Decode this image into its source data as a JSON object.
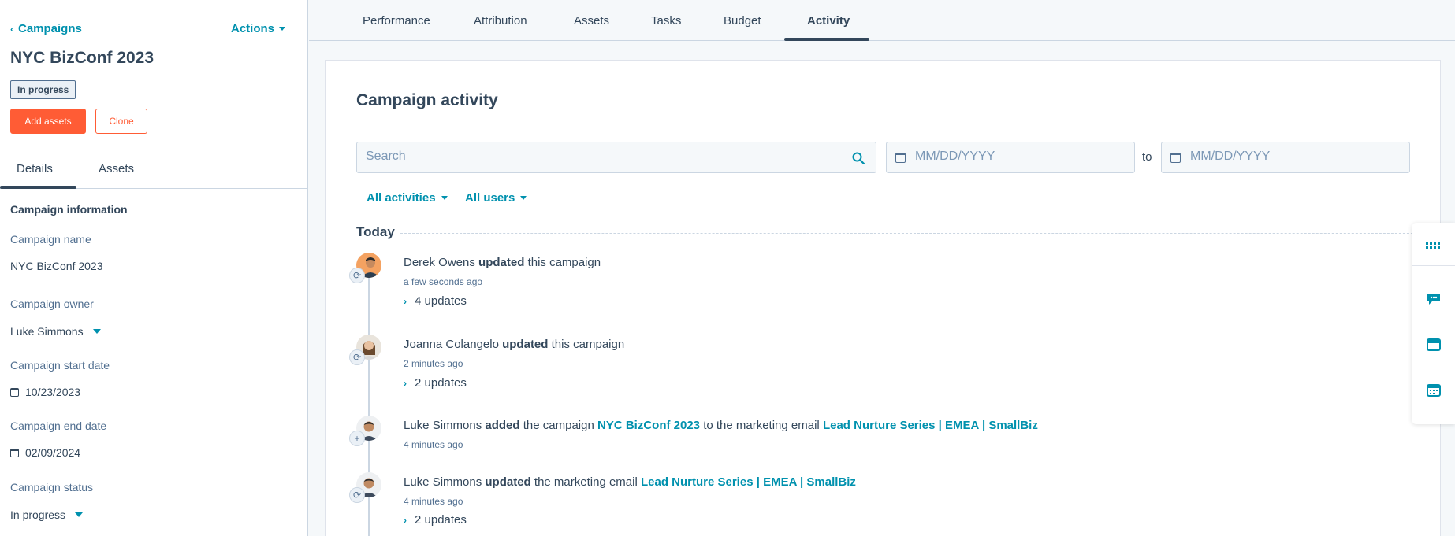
{
  "sidebar": {
    "back_label": "Campaigns",
    "actions_label": "Actions",
    "title": "NYC BizConf 2023",
    "status_badge": "In progress",
    "add_assets_label": "Add assets",
    "clone_label": "Clone",
    "tabs": [
      {
        "label": "Details"
      },
      {
        "label": "Assets"
      }
    ],
    "section_title": "Campaign information",
    "fields": {
      "name": {
        "label": "Campaign name",
        "value": "NYC BizConf 2023"
      },
      "owner": {
        "label": "Campaign owner",
        "value": "Luke Simmons"
      },
      "start": {
        "label": "Campaign start date",
        "value": "10/23/2023"
      },
      "end": {
        "label": "Campaign end date",
        "value": "02/09/2024"
      },
      "status": {
        "label": "Campaign status",
        "value": "In progress"
      }
    }
  },
  "topnav": {
    "tabs": [
      {
        "label": "Performance"
      },
      {
        "label": "Attribution"
      },
      {
        "label": "Assets"
      },
      {
        "label": "Tasks"
      },
      {
        "label": "Budget"
      },
      {
        "label": "Activity"
      }
    ],
    "active": "Activity"
  },
  "main": {
    "title": "Campaign activity",
    "search_placeholder": "Search",
    "date_from_placeholder": "MM/DD/YYYY",
    "to_label": "to",
    "date_to_placeholder": "MM/DD/YYYY",
    "filters": {
      "activities": "All activities",
      "users": "All users"
    },
    "today_label": "Today",
    "entries": [
      {
        "user": "Derek Owens",
        "action": "updated",
        "rest": "this campaign",
        "time": "a few seconds ago",
        "updates": "4 updates"
      },
      {
        "user": "Joanna Colangelo",
        "action": "updated",
        "rest": "this campaign",
        "time": "2 minutes ago",
        "updates": "2 updates"
      },
      {
        "user": "Luke Simmons",
        "action": "added",
        "pre": "the campaign",
        "link1": "NYC BizConf 2023",
        "mid": "to the marketing email",
        "link2": "Lead Nurture Series | EMEA | SmallBiz",
        "time": "4 minutes ago"
      },
      {
        "user": "Luke Simmons",
        "action": "updated",
        "pre": "the marketing email",
        "link1": "Lead Nurture Series | EMEA | SmallBiz",
        "time": "4 minutes ago",
        "updates": "2 updates"
      }
    ]
  },
  "colors": {
    "accent": "#0091ae",
    "primary_button": "#ff5c35",
    "text": "#33475b"
  },
  "icons": {
    "search": "search-icon",
    "calendar": "calendar-icon",
    "sync": "sync-icon",
    "add": "plus-icon",
    "rail": [
      "grid-icon",
      "chat-icon",
      "inbox-icon",
      "calendar-icon"
    ]
  }
}
